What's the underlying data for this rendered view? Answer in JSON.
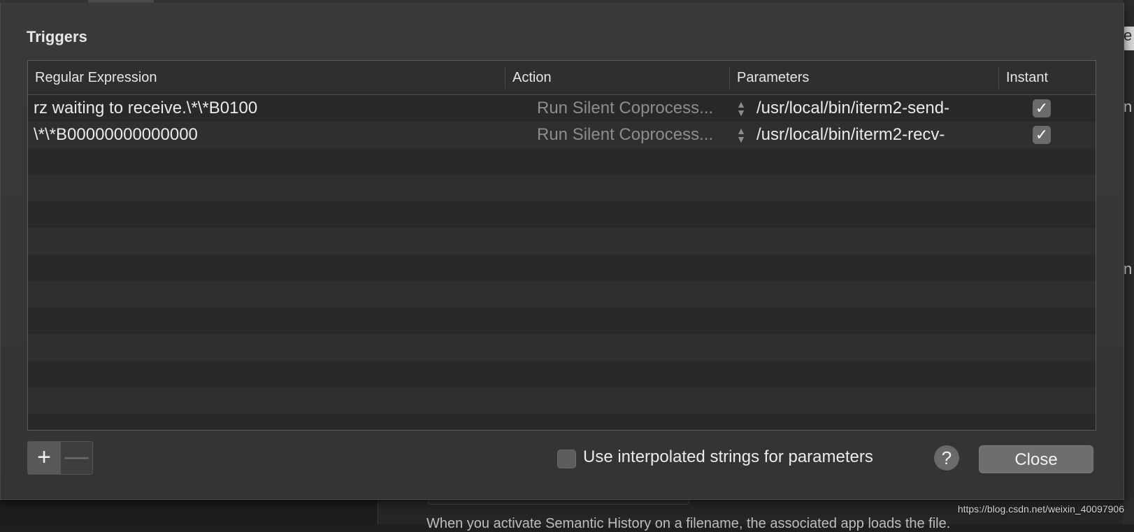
{
  "background": {
    "bottom_text": "When you activate Semantic History on a filename, the associated app loads the file.",
    "right_glyphs": [
      "e",
      "n",
      "n"
    ],
    "watermark": "https://blog.csdn.net/weixin_40097906"
  },
  "sheet": {
    "title": "Triggers",
    "table": {
      "columns": [
        "Regular Expression",
        "Action",
        "Parameters",
        "Instant"
      ],
      "rows": [
        {
          "regex": "rz waiting to receive.\\*\\*B0100",
          "action": "Run Silent Coprocess...",
          "parameters": "/usr/local/bin/iterm2-send-",
          "instant": true,
          "instant_mark": "✓"
        },
        {
          "regex": "\\*\\*B00000000000000",
          "action": "Run Silent Coprocess...",
          "parameters": "/usr/local/bin/iterm2-recv-",
          "instant": true,
          "instant_mark": "✓"
        }
      ],
      "empty_row_count": 11
    },
    "add_button": "+",
    "remove_button": "—",
    "use_interpolated_label": "Use interpolated strings for parameters",
    "use_interpolated_checked": false,
    "help_label": "?",
    "close_label": "Close"
  }
}
